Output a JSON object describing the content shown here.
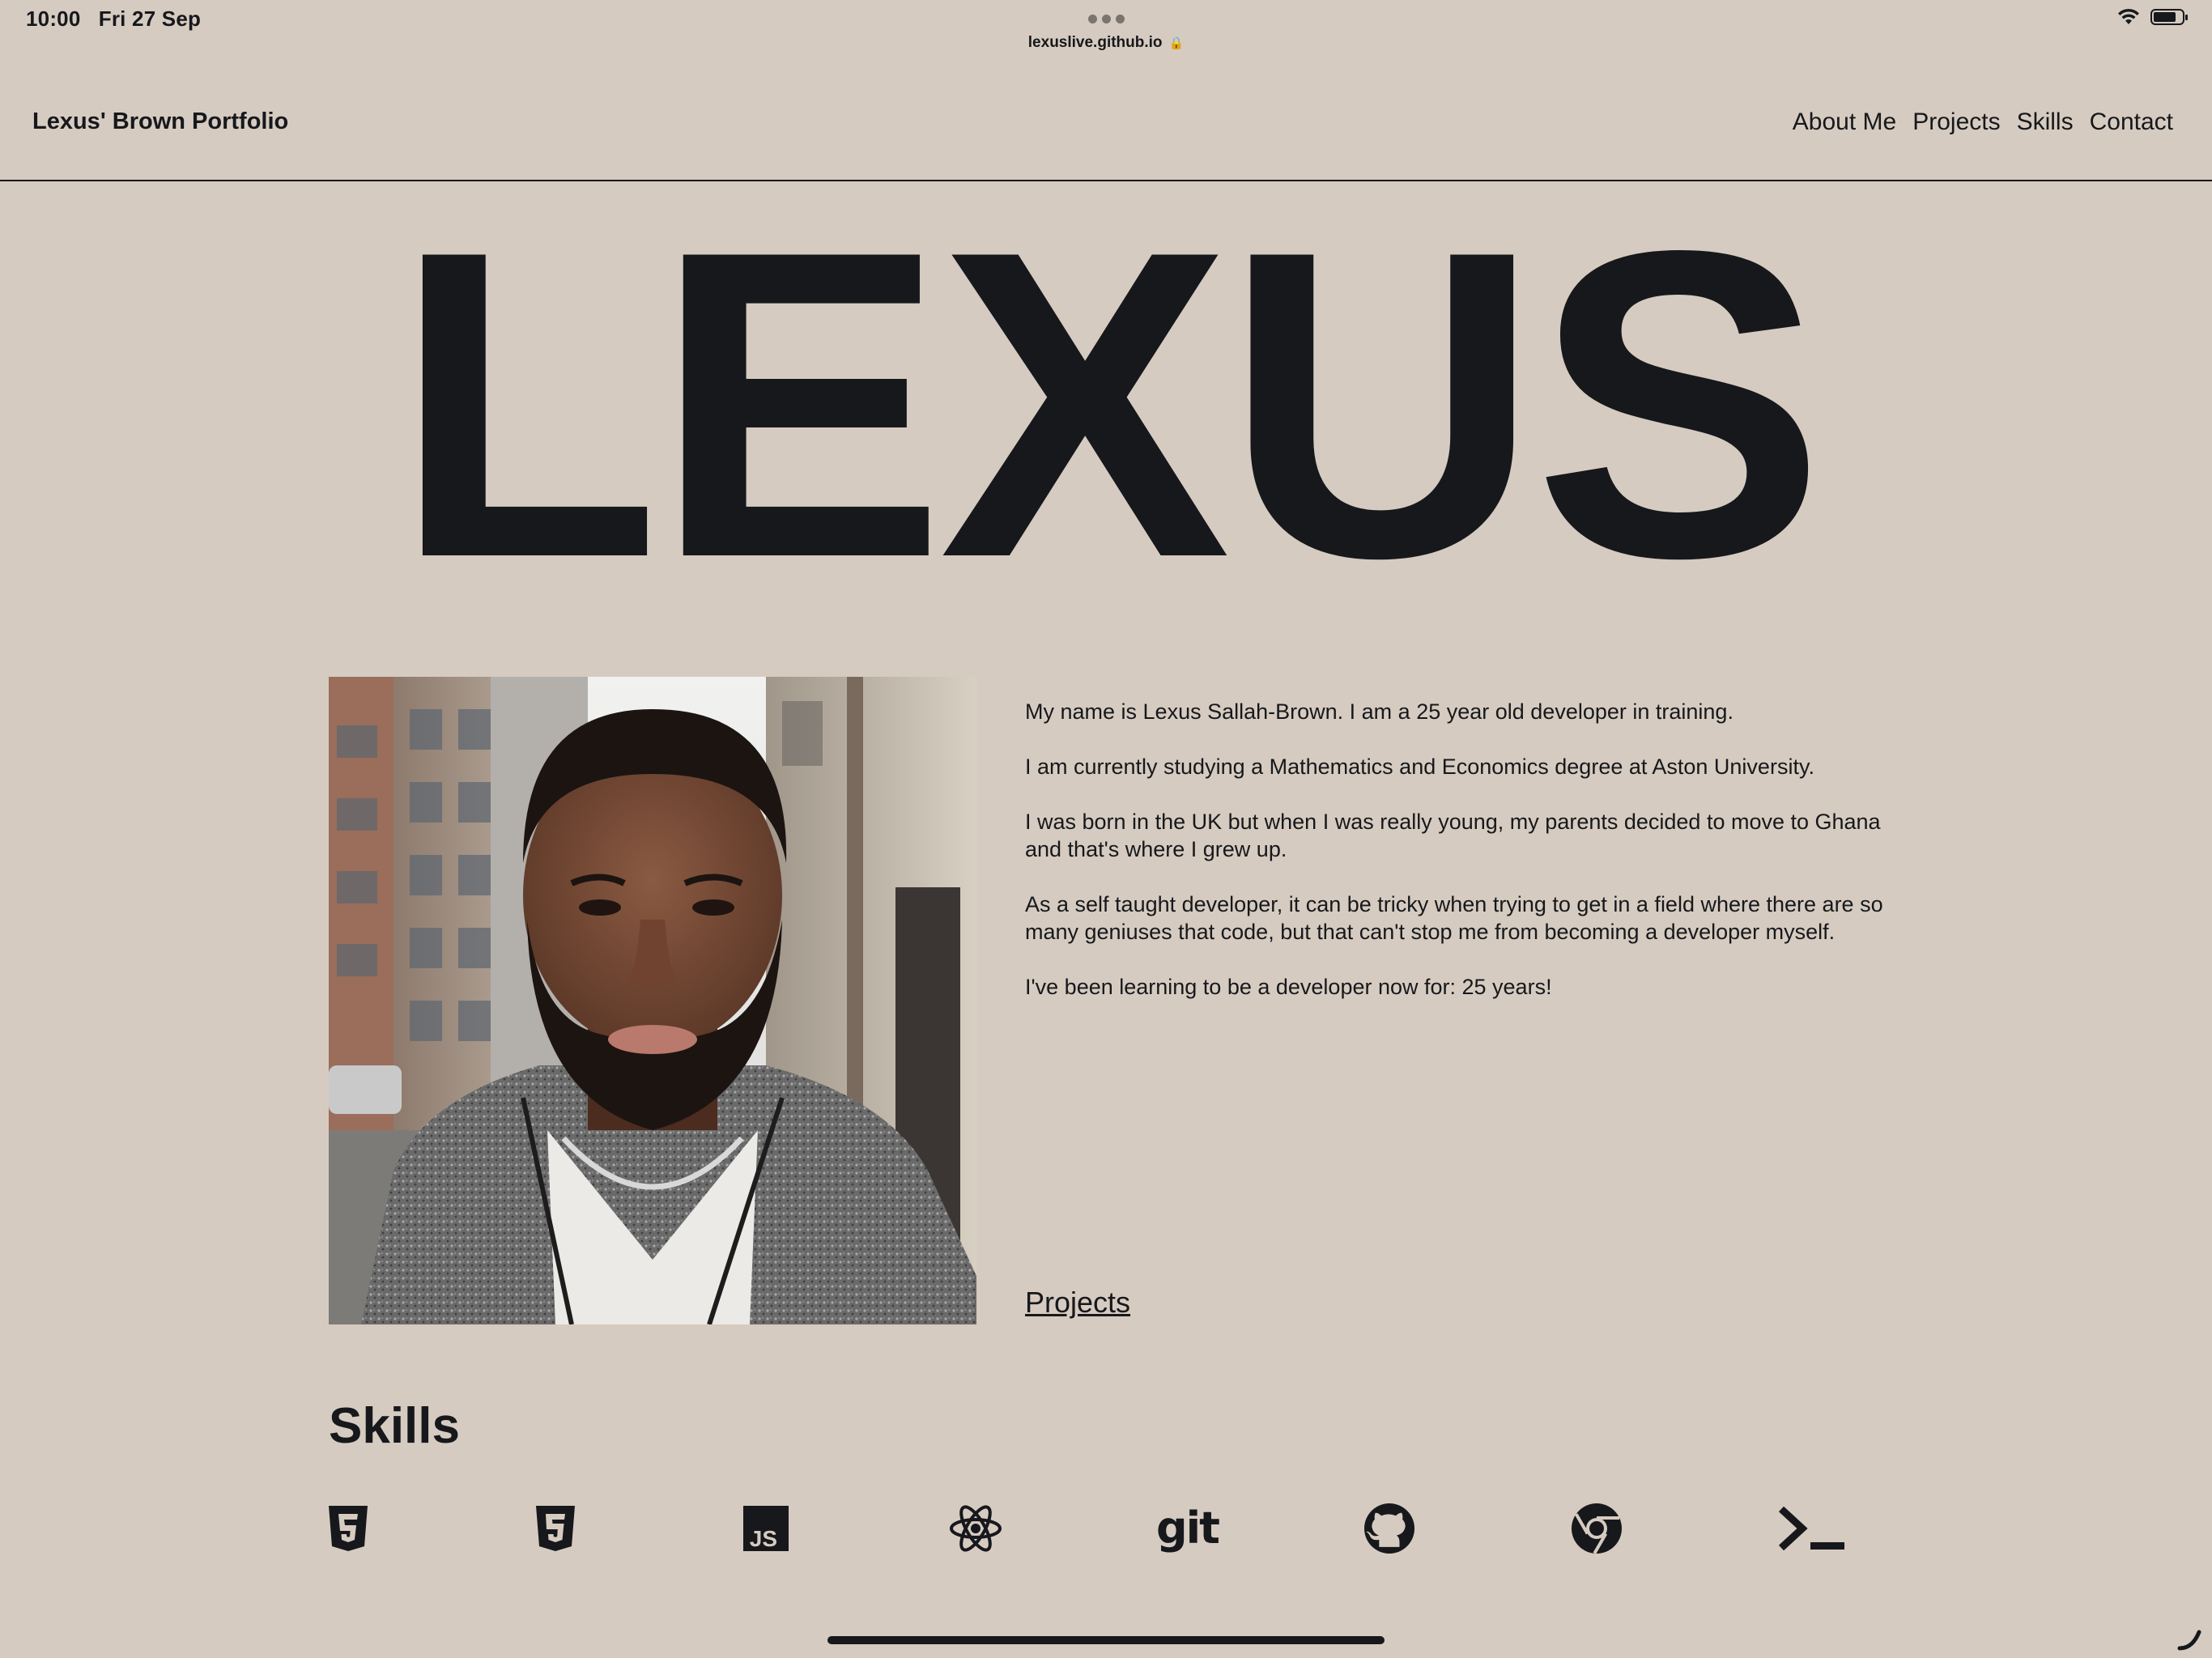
{
  "status_bar": {
    "time": "10:00",
    "date": "Fri 27 Sep",
    "url": "lexuslive.github.io"
  },
  "nav": {
    "brand": "Lexus' Brown Portfolio",
    "links": [
      "About Me",
      "Projects",
      "Skills",
      "Contact"
    ]
  },
  "hero": {
    "title": "LEXUS"
  },
  "about": {
    "paragraphs": [
      "My name is Lexus Sallah-Brown. I am a 25 year old developer in training.",
      "I am currently studying a Mathematics and Economics degree at Aston University.",
      "I was born in the UK but when I was really young, my parents decided to move to Ghana and that's where I grew up.",
      "As a self taught developer, it can be tricky when trying to get in a field where there are so many geniuses that code, but that can't stop me from becoming a developer myself.",
      "I've been learning to be a developer now for: 25 years!"
    ],
    "projects_link": "Projects"
  },
  "skills": {
    "title": "Skills",
    "icons": [
      "html5-icon",
      "css3-icon",
      "javascript-icon",
      "react-icon",
      "git-icon",
      "github-icon",
      "chrome-icon",
      "terminal-icon"
    ],
    "git_text": "git",
    "js_text": "JS"
  },
  "colors": {
    "background": "#d6cbc0",
    "text": "#16181c"
  }
}
